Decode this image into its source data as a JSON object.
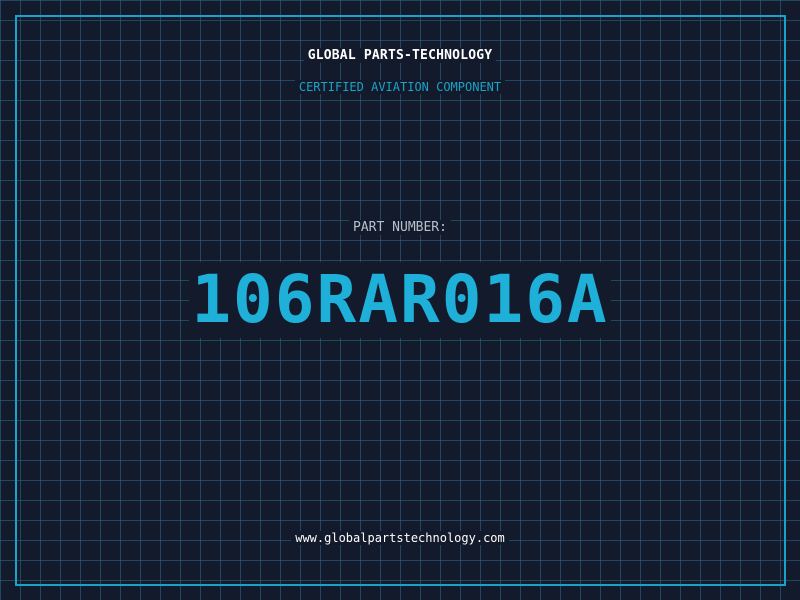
{
  "brand": {
    "name": "GLOBAL PARTS-TECHNOLOGY",
    "tagline": "CERTIFIED AVIATION COMPONENT"
  },
  "part": {
    "label": "PART NUMBER:",
    "number": "106RAR016A"
  },
  "footer": {
    "website": "www.globalpartstechnology.com"
  },
  "colors": {
    "background": "#131a2c",
    "grid": "#2c6e87",
    "accent": "#1aa3c8",
    "part_number": "#1eb0d8",
    "text_primary": "#ffffff",
    "text_secondary": "#b7c0cc"
  }
}
